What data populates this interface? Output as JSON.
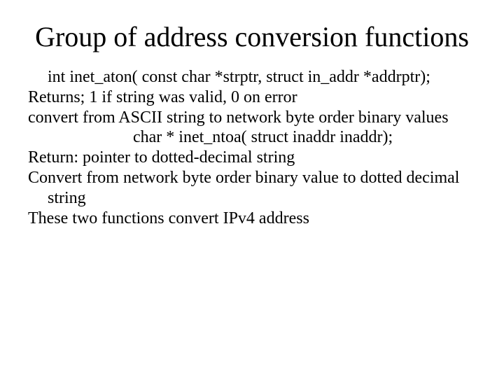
{
  "title": "Group of address conversion functions",
  "lines": {
    "sig1": "int inet_aton( const char *strptr, struct in_addr *addrptr);",
    "ret1": "Returns; 1 if string was valid, 0 on error",
    "desc1": "convert from ASCII string to network byte order binary values",
    "sig2": "char *  inet_ntoa( struct inaddr inaddr);",
    "ret2": "Return: pointer to dotted-decimal string",
    "desc2": "Convert from network byte order binary value to dotted decimal string",
    "note": "These two functions convert IPv4 address"
  }
}
